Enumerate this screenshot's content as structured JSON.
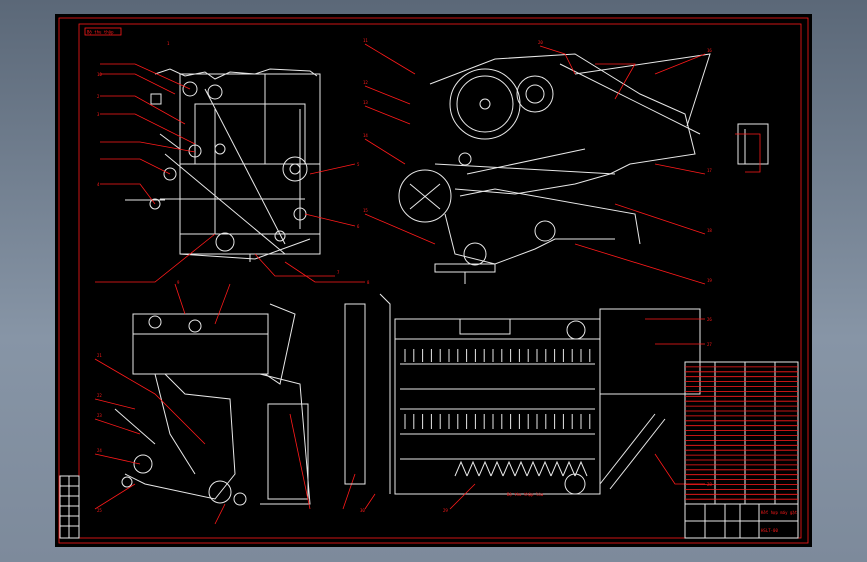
{
  "drawing": {
    "frame_note": "Bộ thu thập",
    "title_block": {
      "name_cell": "Kết hợp máy gặt",
      "drawing_no": "HSLT-00"
    },
    "leaders": {
      "left_view": [
        "1",
        "2",
        "3",
        "4",
        "5",
        "6",
        "7",
        "8",
        "9",
        "10"
      ],
      "right_view": [
        "11",
        "12",
        "13",
        "14",
        "15",
        "16",
        "17",
        "18",
        "19",
        "20"
      ],
      "bottom_views": [
        "21",
        "22",
        "23",
        "24",
        "25",
        "26",
        "27",
        "28",
        "29",
        "30"
      ]
    },
    "bottom_caption": "Bộ thu thập lúa",
    "colors": {
      "sheet": "#000000",
      "geometry": "#e8e8e8",
      "annotation": "#ff1a1a",
      "desktop": "#7d8a9b"
    }
  }
}
